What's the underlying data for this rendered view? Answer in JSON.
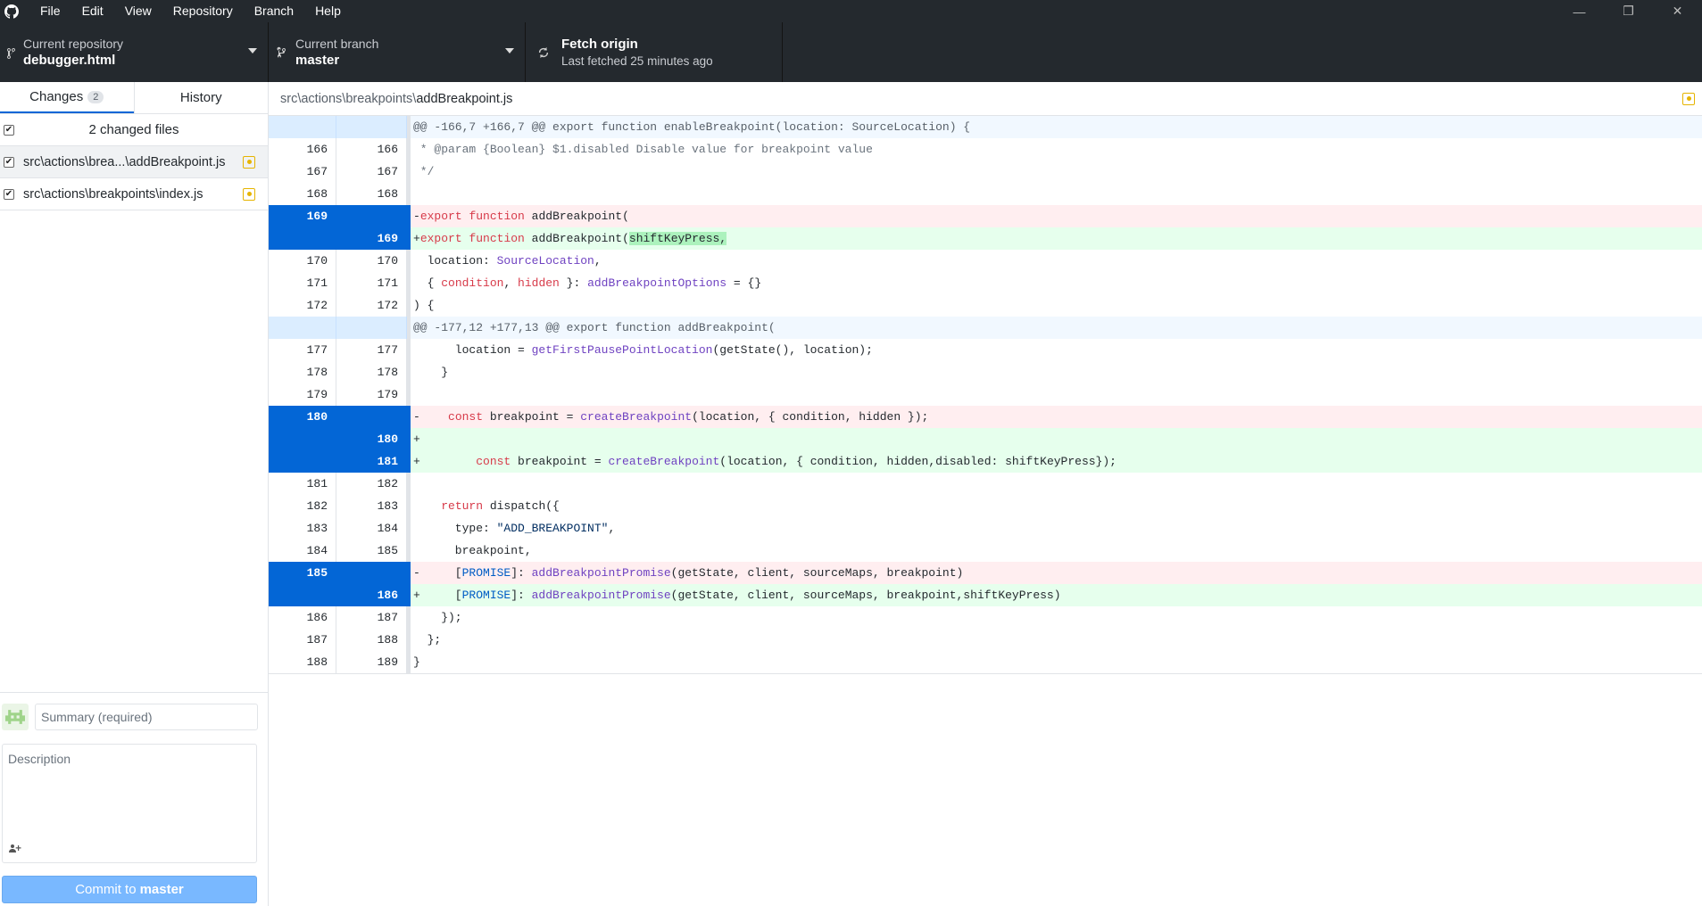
{
  "menu": {
    "items": [
      "File",
      "Edit",
      "View",
      "Repository",
      "Branch",
      "Help"
    ]
  },
  "window": {
    "minimize": "—",
    "restore": "❐",
    "close": "✕"
  },
  "toolbar": {
    "repo_label": "Current repository",
    "repo_value": "debugger.html",
    "branch_label": "Current branch",
    "branch_value": "master",
    "fetch_label": "Fetch origin",
    "fetch_sub": "Last fetched 25 minutes ago"
  },
  "sidebar": {
    "tab_changes": "Changes",
    "tab_changes_count": "2",
    "tab_history": "History",
    "changed_files_text": "2 changed files",
    "files": [
      {
        "path": "src\\actions\\brea...\\addBreakpoint.js"
      },
      {
        "path": "src\\actions\\breakpoints\\index.js"
      }
    ]
  },
  "commit": {
    "summary_placeholder": "Summary (required)",
    "description_placeholder": "Description",
    "button_prefix": "Commit to",
    "button_branch": "master"
  },
  "diff": {
    "file_dir": "src\\actions\\breakpoints\\",
    "file_name": "addBreakpoint.js",
    "lines": [
      {
        "type": "hunk",
        "old": "",
        "new": "",
        "text": "@@ -166,7 +166,7 @@ export function enableBreakpoint(location: SourceLocation) {"
      },
      {
        "type": "ctx",
        "old": "166",
        "new": "166",
        "text": " * @param {Boolean} $1.disabled Disable value for breakpoint value"
      },
      {
        "type": "ctx",
        "old": "167",
        "new": "167",
        "text": " */"
      },
      {
        "type": "ctx",
        "old": "168",
        "new": "168",
        "text": ""
      },
      {
        "type": "del",
        "old": "169",
        "new": "",
        "text": "-export function addBreakpoint("
      },
      {
        "type": "add",
        "old": "",
        "new": "169",
        "text": "+export function addBreakpoint(shiftKeyPress,"
      },
      {
        "type": "ctx",
        "old": "170",
        "new": "170",
        "text": "  location: SourceLocation,"
      },
      {
        "type": "ctx",
        "old": "171",
        "new": "171",
        "text": "  { condition, hidden }: addBreakpointOptions = {}"
      },
      {
        "type": "ctx",
        "old": "172",
        "new": "172",
        "text": ") {"
      },
      {
        "type": "hunk",
        "old": "",
        "new": "",
        "text": "@@ -177,12 +177,13 @@ export function addBreakpoint("
      },
      {
        "type": "ctx",
        "old": "177",
        "new": "177",
        "text": "      location = getFirstPausePointLocation(getState(), location);"
      },
      {
        "type": "ctx",
        "old": "178",
        "new": "178",
        "text": "    }"
      },
      {
        "type": "ctx",
        "old": "179",
        "new": "179",
        "text": ""
      },
      {
        "type": "del",
        "old": "180",
        "new": "",
        "text": "-    const breakpoint = createBreakpoint(location, { condition, hidden });"
      },
      {
        "type": "add",
        "old": "",
        "new": "180",
        "text": "+"
      },
      {
        "type": "add",
        "old": "",
        "new": "181",
        "text": "+        const breakpoint = createBreakpoint(location, { condition, hidden,disabled: shiftKeyPress});"
      },
      {
        "type": "ctx",
        "old": "181",
        "new": "182",
        "text": ""
      },
      {
        "type": "ctx",
        "old": "182",
        "new": "183",
        "text": "    return dispatch({"
      },
      {
        "type": "ctx",
        "old": "183",
        "new": "184",
        "text": "      type: \"ADD_BREAKPOINT\","
      },
      {
        "type": "ctx",
        "old": "184",
        "new": "185",
        "text": "      breakpoint,"
      },
      {
        "type": "del",
        "old": "185",
        "new": "",
        "text": "-     [PROMISE]: addBreakpointPromise(getState, client, sourceMaps, breakpoint)"
      },
      {
        "type": "add",
        "old": "",
        "new": "186",
        "text": "+     [PROMISE]: addBreakpointPromise(getState, client, sourceMaps, breakpoint,shiftKeyPress)"
      },
      {
        "type": "ctx",
        "old": "186",
        "new": "187",
        "text": "    });"
      },
      {
        "type": "ctx",
        "old": "187",
        "new": "188",
        "text": "  };"
      },
      {
        "type": "ctx",
        "old": "188",
        "new": "189",
        "text": "}"
      }
    ]
  }
}
